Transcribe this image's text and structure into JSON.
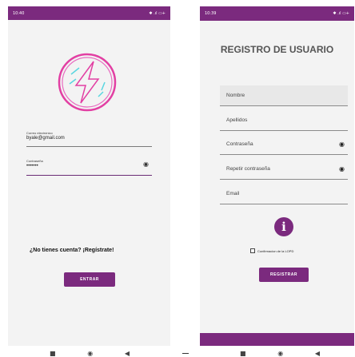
{
  "left_phone": {
    "status_time": "10:40",
    "status_right": "✱ .ıl ▭+",
    "email_label": "Correo electrónico",
    "email_value": "byale@gmail.com",
    "password_label": "Contraseña",
    "password_value": "•••••••",
    "no_account_text": "¿No tienes cuenta? ¡Regístrate!",
    "login_button": "ENTRAR"
  },
  "right_phone": {
    "status_time": "10:39",
    "status_right": "✱ .ıl ▭+",
    "title": "REGISTRO DE USUARIO",
    "fields": [
      {
        "placeholder": "Nombre"
      },
      {
        "placeholder": "Apellidos"
      },
      {
        "placeholder": "Contraseña"
      },
      {
        "placeholder": "Repetir contraseña"
      },
      {
        "placeholder": "Email"
      }
    ],
    "lopd_label": "Confirmacion de la LOPD",
    "register_button": "REGISTRAR"
  },
  "icons": {
    "logo": "lightning-bolt-circle-logo",
    "eye": "eye-icon",
    "info": "info-icon",
    "nav_square": "■",
    "nav_circle": "◉",
    "nav_back": "◀"
  },
  "colors": {
    "primary": "#7b2a7e",
    "background": "#f3f3f3",
    "logo_pink": "#e23fa3",
    "logo_cyan": "#59d6e0"
  }
}
